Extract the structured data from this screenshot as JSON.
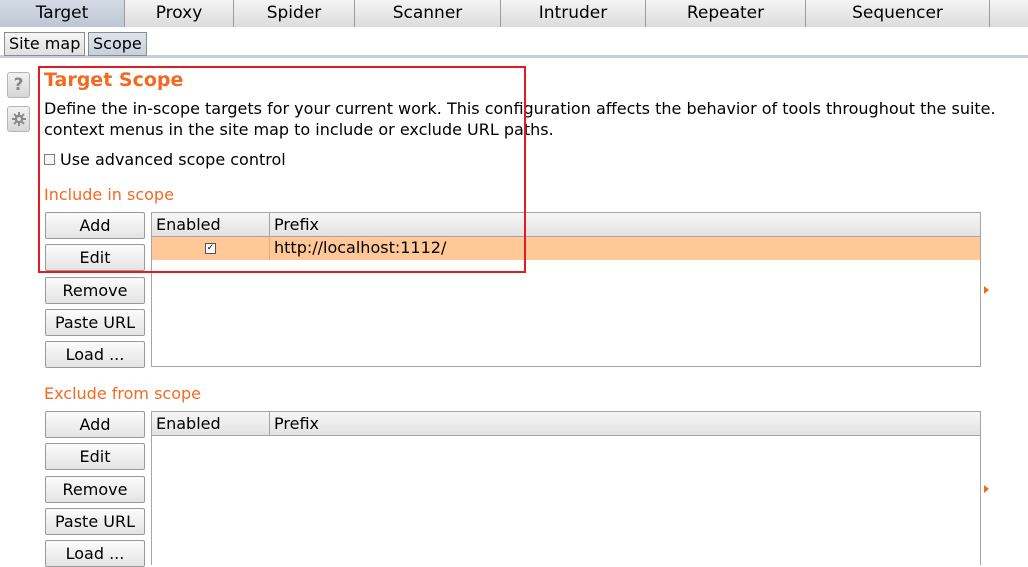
{
  "tabs": [
    "Target",
    "Proxy",
    "Spider",
    "Scanner",
    "Intruder",
    "Repeater",
    "Sequencer"
  ],
  "subtabs": [
    "Site map",
    "Scope"
  ],
  "side_icons": {
    "help": "?",
    "settings": "gear-icon"
  },
  "title": "Target Scope",
  "description": {
    "line1": "Define the in-scope targets for your current work. This configuration affects the behavior of tools throughout the suite.",
    "line2": "context menus in the site map to include or exclude URL paths."
  },
  "advanced_scope_label": "Use advanced scope control",
  "include": {
    "label": "Include in scope",
    "buttons": [
      "Add",
      "Edit",
      "Remove",
      "Paste URL",
      "Load ..."
    ],
    "columns": [
      "Enabled",
      "Prefix"
    ],
    "rows": [
      {
        "enabled": true,
        "prefix": "http://localhost:1112/"
      }
    ]
  },
  "exclude": {
    "label": "Exclude from scope",
    "buttons": [
      "Add",
      "Edit",
      "Remove",
      "Paste URL",
      "Load ..."
    ],
    "columns": [
      "Enabled",
      "Prefix"
    ],
    "rows": []
  },
  "colors": {
    "accent": "#f26a22",
    "selected_row": "#ffc896",
    "highlight_box": "#e01b24"
  }
}
